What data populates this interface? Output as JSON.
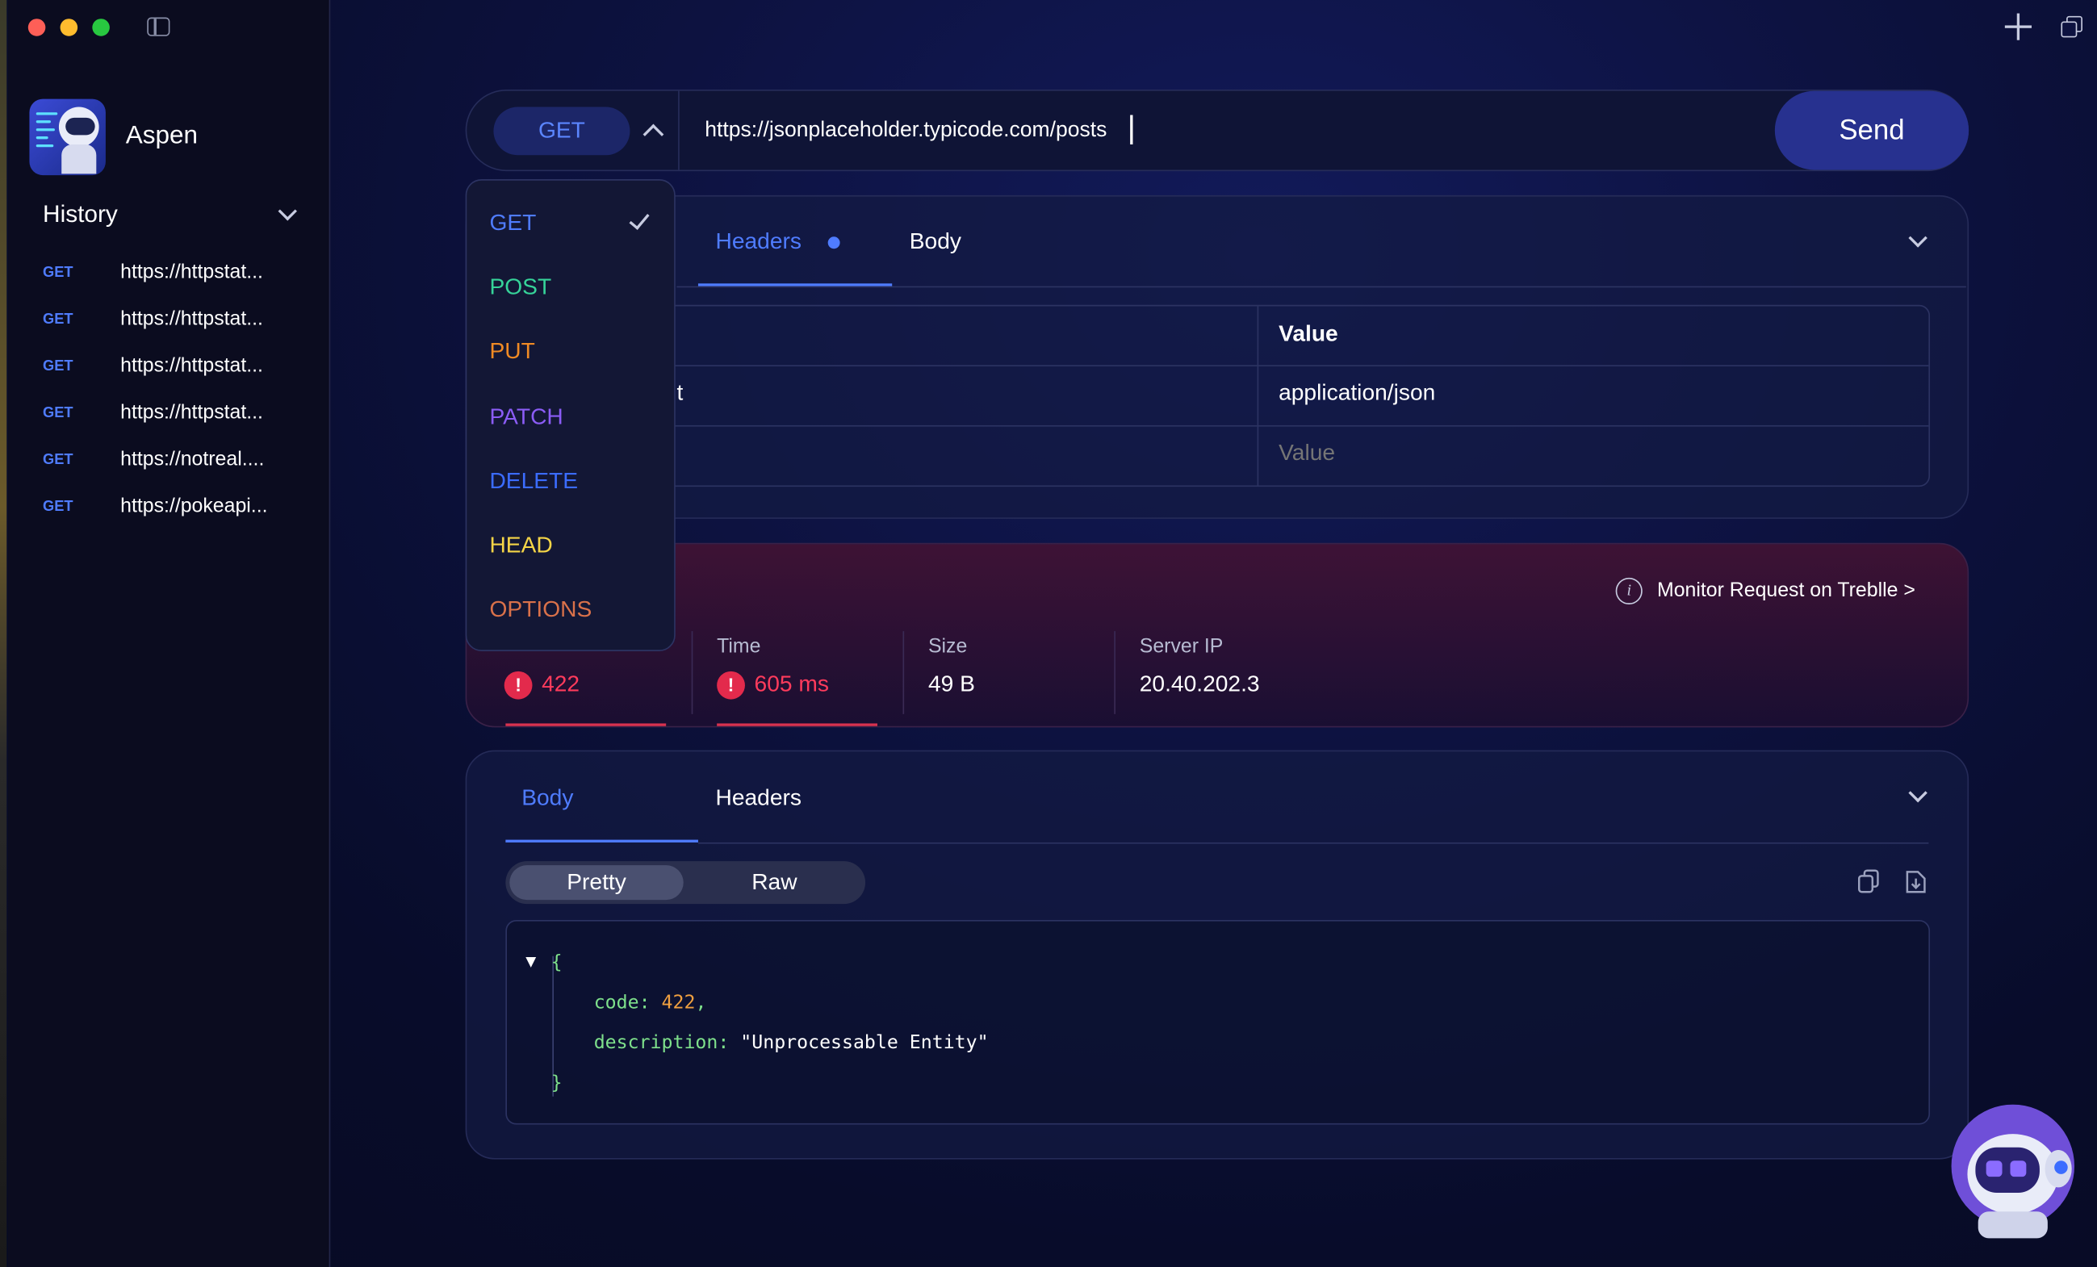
{
  "app": {
    "name": "Aspen"
  },
  "sidebar": {
    "history_title": "History",
    "items": [
      {
        "method": "GET",
        "url": "https://httpstat..."
      },
      {
        "method": "GET",
        "url": "https://httpstat..."
      },
      {
        "method": "GET",
        "url": "https://httpstat..."
      },
      {
        "method": "GET",
        "url": "https://httpstat..."
      },
      {
        "method": "GET",
        "url": "https://notreal...."
      },
      {
        "method": "GET",
        "url": "https://pokeapi..."
      }
    ]
  },
  "request": {
    "method": "GET",
    "url": "https://jsonplaceholder.typicode.com/posts",
    "send_label": "Send",
    "tabs": [
      "Headers",
      "Body"
    ],
    "active_tab": "Headers",
    "headers_table": {
      "value_header": "Value",
      "rows": [
        {
          "key_fragment": "t",
          "value": "application/json"
        }
      ],
      "value_placeholder": "Value"
    }
  },
  "method_menu": {
    "selected": "GET",
    "options": [
      {
        "label": "GET",
        "color": "#4f7cff"
      },
      {
        "label": "POST",
        "color": "#36d399"
      },
      {
        "label": "PUT",
        "color": "#f08a24"
      },
      {
        "label": "PATCH",
        "color": "#8b5cf6"
      },
      {
        "label": "DELETE",
        "color": "#3b6cff"
      },
      {
        "label": "HEAD",
        "color": "#f5d547"
      },
      {
        "label": "OPTIONS",
        "color": "#d9714a"
      }
    ]
  },
  "response": {
    "monitor_link": "Monitor Request on Treblle >",
    "time_label": "Time",
    "size_label": "Size",
    "server_ip_label": "Server IP",
    "status": "422",
    "time": "605 ms",
    "size": "49 B",
    "server_ip": "20.40.202.3",
    "tabs": [
      "Body",
      "Headers"
    ],
    "active_tab": "Body",
    "view_modes": [
      "Pretty",
      "Raw"
    ],
    "active_view": "Pretty",
    "body": {
      "open_brace": "{",
      "close_brace": "}",
      "line1_key": "code:",
      "line1_val": "422",
      "line1_comma": ",",
      "line2_key": "description:",
      "line2_val": "\"Unprocessable Entity\""
    }
  },
  "colors": {
    "accent": "#4f7cff",
    "error": "#e32a4c",
    "send_bg": "#27318f"
  },
  "icons": [
    "sidebar-toggle-icon",
    "plus-icon",
    "duplicate-window-icon",
    "chevron-down-icon",
    "chevron-up-icon",
    "check-icon",
    "info-icon",
    "error-icon",
    "copy-icon",
    "download-icon"
  ]
}
